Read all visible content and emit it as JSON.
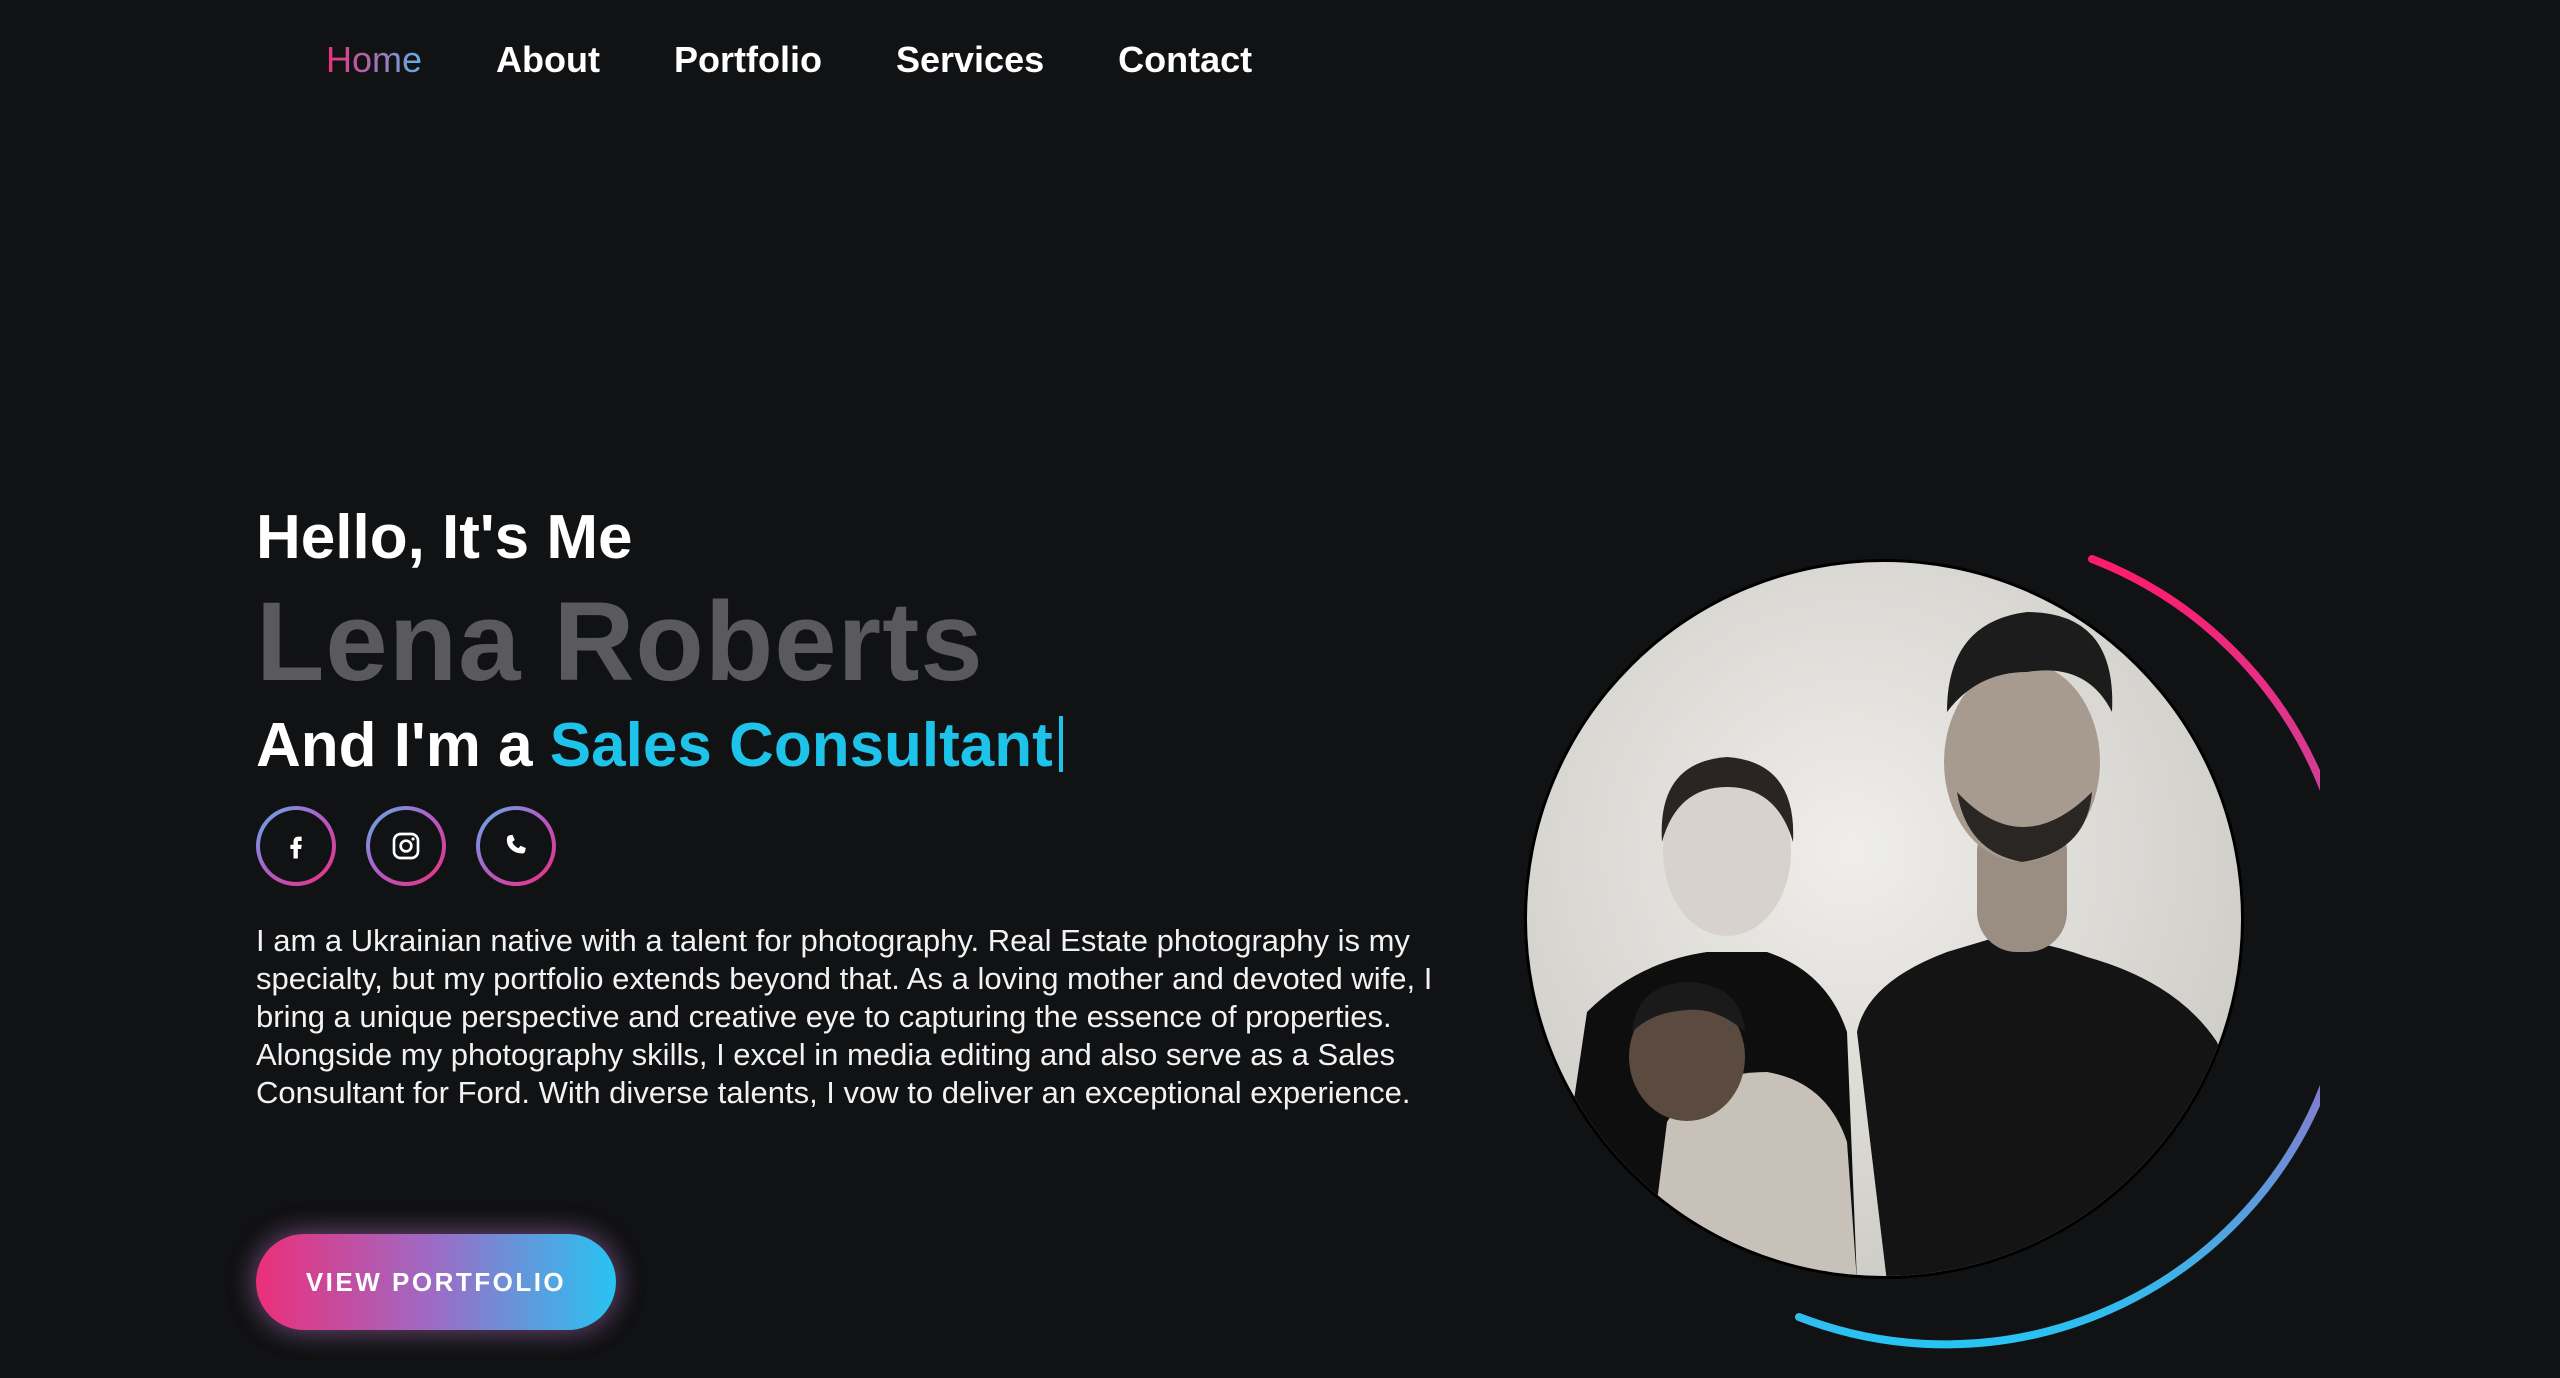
{
  "nav": {
    "items": [
      {
        "label": "Home",
        "active": true
      },
      {
        "label": "About",
        "active": false
      },
      {
        "label": "Portfolio",
        "active": false
      },
      {
        "label": "Services",
        "active": false
      },
      {
        "label": "Contact",
        "active": false
      }
    ]
  },
  "hero": {
    "greeting": "Hello, It's Me",
    "name": "Lena Roberts",
    "role_prefix": "And I'm a",
    "role": "Sales Consultant",
    "socials": [
      {
        "icon": "facebook-icon"
      },
      {
        "icon": "instagram-icon"
      },
      {
        "icon": "phone-icon"
      }
    ],
    "bio": "I am a Ukrainian native with a talent for photography. Real Estate photography is my specialty, but my portfolio extends beyond that. As a loving mother and devoted wife, I bring a unique perspective and creative eye to capturing the essence of properties. Alongside my photography skills, I excel in media editing and also serve as a Sales Consultant for Ford. With diverse talents, I vow to deliver an exceptional experience.",
    "cta_label": "VIEW PORTFOLIO"
  },
  "colors": {
    "background": "#111214",
    "accent_pink": "#ec2f7a",
    "accent_blue": "#27c4f2",
    "role_color": "#1ec3ea",
    "name_color": "#5a5a5c"
  }
}
